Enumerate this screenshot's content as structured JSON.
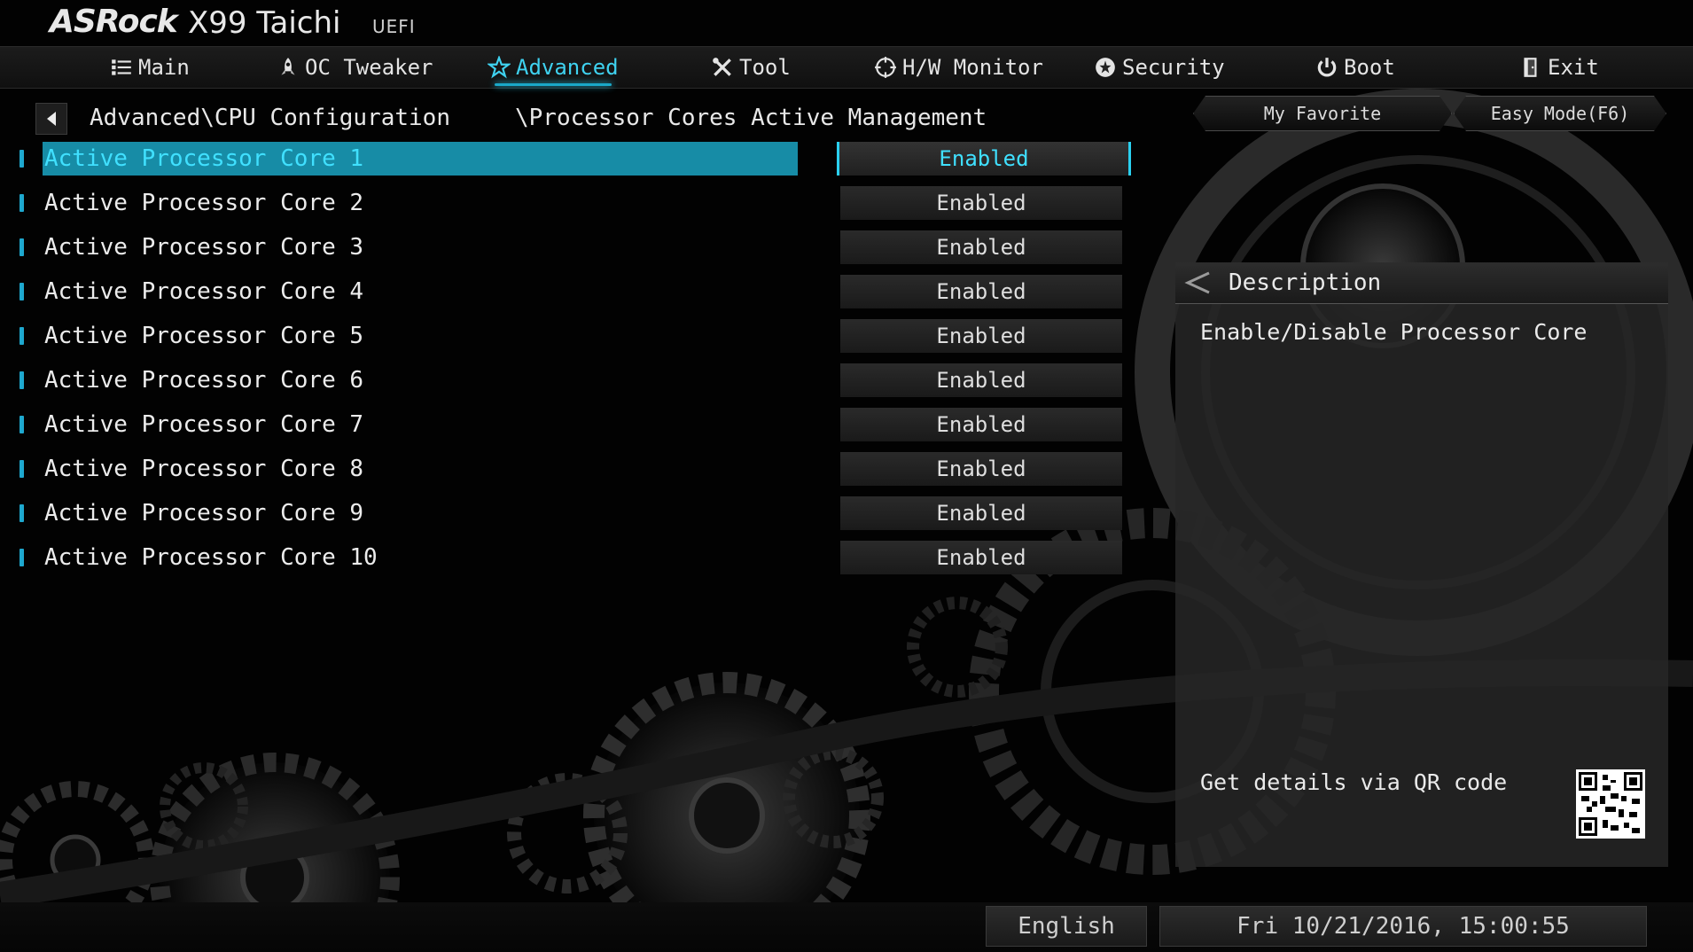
{
  "header": {
    "brand": "ASRock",
    "model": "X99 Taichi",
    "suffix": "UEFI"
  },
  "nav": {
    "tabs": [
      {
        "label": "Main",
        "icon": "list-icon",
        "active": false
      },
      {
        "label": "OC Tweaker",
        "icon": "rocket-icon",
        "active": false
      },
      {
        "label": "Advanced",
        "icon": "star-icon",
        "active": true
      },
      {
        "label": "Tool",
        "icon": "tools-icon",
        "active": false
      },
      {
        "label": "H/W Monitor",
        "icon": "crosshair-icon",
        "active": false
      },
      {
        "label": "Security",
        "icon": "shield-icon",
        "active": false
      },
      {
        "label": "Boot",
        "icon": "power-icon",
        "active": false
      },
      {
        "label": "Exit",
        "icon": "exit-door-icon",
        "active": false
      }
    ]
  },
  "breadcrumb": {
    "path": "Advanced\\CPU Configuration",
    "sub": "\\Processor Cores Active Management"
  },
  "buttons": {
    "favorite": "My Favorite",
    "easy_mode": "Easy Mode(F6)"
  },
  "settings": [
    {
      "label": "Active Processor Core 1",
      "value": "Enabled",
      "selected": true
    },
    {
      "label": "Active Processor Core 2",
      "value": "Enabled"
    },
    {
      "label": "Active Processor Core 3",
      "value": "Enabled"
    },
    {
      "label": "Active Processor Core 4",
      "value": "Enabled"
    },
    {
      "label": "Active Processor Core 5",
      "value": "Enabled"
    },
    {
      "label": "Active Processor Core 6",
      "value": "Enabled"
    },
    {
      "label": "Active Processor Core 7",
      "value": "Enabled"
    },
    {
      "label": "Active Processor Core 8",
      "value": "Enabled"
    },
    {
      "label": "Active Processor Core 9",
      "value": "Enabled"
    },
    {
      "label": "Active Processor Core 10",
      "value": "Enabled"
    }
  ],
  "description": {
    "title": "Description",
    "text": "Enable/Disable Processor Core",
    "qr_text": "Get details via QR code"
  },
  "status": {
    "language": "English",
    "datetime": "Fri 10/21/2016, 15:00:55"
  },
  "colors": {
    "accent": "#1aa8c8",
    "highlight": "#178ca6",
    "text_active": "#40e0ff"
  }
}
